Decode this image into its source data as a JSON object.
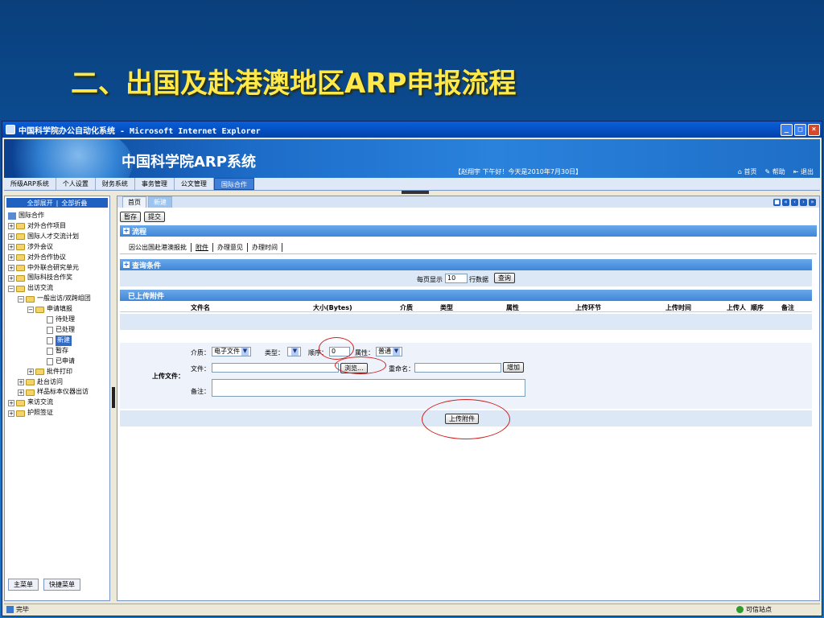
{
  "slide": {
    "title": "二、出国及赴港澳地区ARP申报流程"
  },
  "window": {
    "title": "中国科学院办公自动化系统 - Microsoft Internet Explorer",
    "buttons": {
      "minimize": "_",
      "maximize": "□",
      "close": "×"
    }
  },
  "header": {
    "title": "中国科学院ARP系统",
    "greeting": "【赵翔宇 下午好！今天是2010年7月30日】",
    "links": {
      "home": "首页",
      "help": "帮助",
      "logout": "退出"
    }
  },
  "menu": {
    "items": [
      "所级ARP系统",
      "个人设置",
      "财务系统",
      "事务管理",
      "公文管理",
      "国际合作"
    ],
    "active_index": 5
  },
  "sidebar": {
    "expand_all": "全部展开",
    "sep": "|",
    "collapse_all": "全部折叠",
    "root": "国际合作",
    "items": [
      "对外合作项目",
      "国际人才交流计划",
      "涉外会议",
      "对外合作协议",
      "中外联合研究单元",
      "国际科技合作奖",
      "出访交流",
      "一般出访/双跨组团",
      "申请填报",
      "待处理",
      "已处理",
      "新建",
      "暂存",
      "已申请",
      "批件打印",
      "赴台访问",
      "样品标本仪器出访",
      "来访交流",
      "护照签证"
    ],
    "tabs": {
      "main_menu": "主菜单",
      "quick_menu": "快捷菜单"
    }
  },
  "main": {
    "tabs": {
      "home": "首页",
      "new": "新建"
    },
    "actions": {
      "save_draft": "暂存",
      "submit": "提交"
    },
    "process_section": "流程",
    "subtabs": [
      "因公出国赴港澳报批",
      "附件",
      "办理意见",
      "办理时间"
    ],
    "query_section": "查询条件",
    "query": {
      "per_page_label": "每页显示",
      "per_page_value": "10",
      "rows_label": "行数据",
      "query_button": "查询"
    },
    "attachments_section": "已上传附件",
    "columns": [
      "文件名",
      "大小(Bytes)",
      "介质",
      "类型",
      "属性",
      "上传环节",
      "上传时间",
      "上传人",
      "顺序",
      "备注"
    ],
    "upload": {
      "label": "上传文件：",
      "medium_label": "介质：",
      "medium_value": "电子文件",
      "type_label": "类型：",
      "type_value": "",
      "order_label": "顺序：",
      "order_value": "0",
      "attr_label": "属性：",
      "attr_value": "普通",
      "file_label": "文件：",
      "file_value": "",
      "browse_button": "浏览...",
      "rename_label": "重命名：",
      "rename_value": "",
      "add_button": "增加",
      "note_label": "备注：",
      "note_value": "",
      "upload_button": "上传附件"
    }
  },
  "status": {
    "left": "完毕",
    "right": "可信站点"
  },
  "colors": {
    "slide_title": "#ffe94a",
    "section_bar": "#3f86d8",
    "annotation": "#d02020"
  }
}
